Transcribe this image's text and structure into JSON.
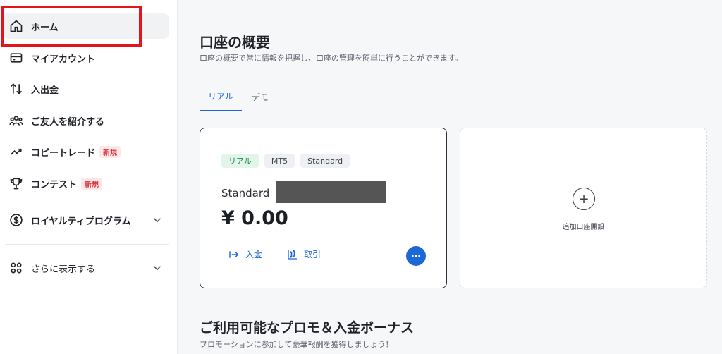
{
  "sidebar": {
    "items": [
      {
        "label": "ホーム",
        "icon": "home-icon"
      },
      {
        "label": "マイアカウント",
        "icon": "card-icon"
      },
      {
        "label": "入出金",
        "icon": "transfer-arrows-icon"
      },
      {
        "label": "ご友人を紹介する",
        "icon": "users-icon"
      },
      {
        "label": "コピートレード",
        "icon": "trend-up-icon",
        "badge": "新規"
      },
      {
        "label": "コンテスト",
        "icon": "trophy-icon",
        "badge": "新規"
      },
      {
        "label": "ロイヤルティプログラム",
        "icon": "dollar-circle-icon"
      },
      {
        "label": "さらに表示する",
        "icon": "grid-icon"
      }
    ]
  },
  "main": {
    "title": "口座の概要",
    "subtitle": "口座の概要で常に情報を把握し、口座の管理を簡単に行うことができます。",
    "tabs": [
      {
        "label": "リアル",
        "active": true
      },
      {
        "label": "デモ",
        "active": false
      }
    ],
    "account_card": {
      "tags": [
        "リアル",
        "MT5",
        "Standard"
      ],
      "name": "Standard",
      "balance": "¥ 0.00",
      "deposit_label": "入金",
      "trade_label": "取引"
    },
    "add_card": {
      "label": "追加口座開設"
    },
    "promo": {
      "title": "ご利用可能なプロモ＆入金ボーナス",
      "subtitle": "プロモーションに参加して豪華報酬を獲得しましょう！"
    }
  },
  "colors": {
    "accent": "#1f68d3",
    "highlight": "#e3141b",
    "badge": "#d9363e"
  }
}
